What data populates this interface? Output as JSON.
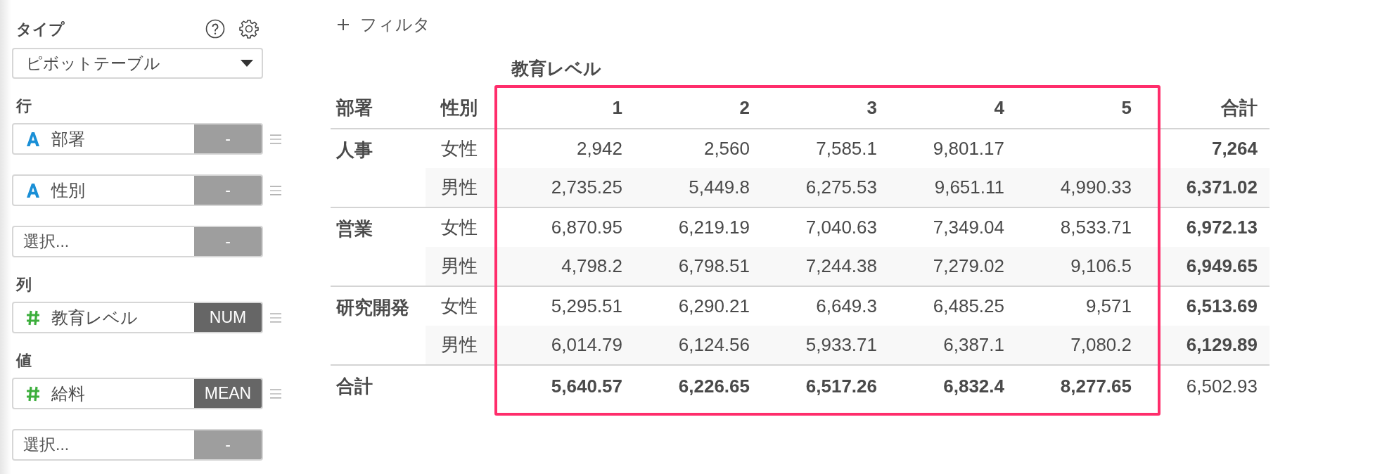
{
  "sidebar": {
    "type_label": "タイプ",
    "type_select": {
      "value": "ピボットテーブル"
    },
    "sections": [
      {
        "label": "行",
        "fields": [
          {
            "kind": "text",
            "name": "部署",
            "agg": "-",
            "agg_set": false
          },
          {
            "kind": "text",
            "name": "性別",
            "agg": "-",
            "agg_set": false
          },
          {
            "kind": "empty",
            "placeholder": "選択...",
            "agg": "-",
            "agg_set": false
          }
        ]
      },
      {
        "label": "列",
        "fields": [
          {
            "kind": "number",
            "name": "教育レベル",
            "agg": "NUM",
            "agg_set": true
          }
        ]
      },
      {
        "label": "値",
        "fields": [
          {
            "kind": "number",
            "name": "給料",
            "agg": "MEAN",
            "agg_set": true
          },
          {
            "kind": "empty",
            "placeholder": "選択...",
            "agg": "-",
            "agg_set": false
          }
        ]
      }
    ]
  },
  "filter": {
    "label": "フィルタ"
  },
  "pivot": {
    "column_group_label": "教育レベル",
    "row_headers": [
      "部署",
      "性別"
    ],
    "columns": [
      "1",
      "2",
      "3",
      "4",
      "5"
    ],
    "total_label": "合計",
    "groups": [
      {
        "name": "人事",
        "rows": [
          {
            "label": "女性",
            "values": [
              "2,942",
              "2,560",
              "7,585.1",
              "9,801.17"
            ],
            "total": "7,264"
          },
          {
            "label": "男性",
            "values": [
              "2,735.25",
              "5,449.8",
              "6,275.53",
              "9,651.11",
              "4,990.33"
            ],
            "total": "6,371.02"
          }
        ]
      },
      {
        "name": "営業",
        "rows": [
          {
            "label": "女性",
            "values": [
              "6,870.95",
              "6,219.19",
              "7,040.63",
              "7,349.04",
              "8,533.71"
            ],
            "total": "6,972.13"
          },
          {
            "label": "男性",
            "values": [
              "4,798.2",
              "6,798.51",
              "7,244.38",
              "7,279.02",
              "9,106.5"
            ],
            "total": "6,949.65"
          }
        ]
      },
      {
        "name": "研究開発",
        "rows": [
          {
            "label": "女性",
            "values": [
              "5,295.51",
              "6,290.21",
              "6,649.3",
              "6,485.25",
              "9,571"
            ],
            "total": "6,513.69"
          },
          {
            "label": "男性",
            "values": [
              "6,014.79",
              "6,124.56",
              "5,933.71",
              "6,387.1",
              "7,080.2"
            ],
            "total": "6,129.89"
          }
        ]
      }
    ],
    "totals_row": {
      "label": "合計",
      "values": [
        "5,640.57",
        "6,226.65",
        "6,517.26",
        "6,832.4",
        "8,277.65"
      ],
      "total": "6,502.93"
    },
    "highlight": {
      "color": "#ff2d6b"
    }
  }
}
